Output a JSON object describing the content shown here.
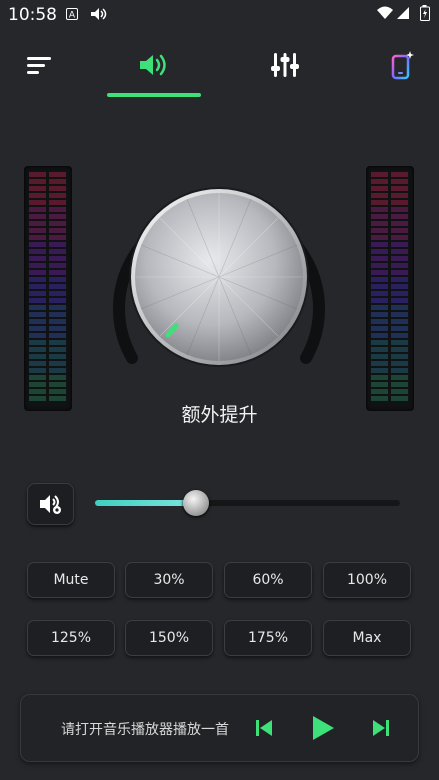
{
  "status_bar": {
    "time": "10:58",
    "icons": [
      "a-badge-icon",
      "sound-indicator-icon",
      "wifi-icon",
      "signal-icon",
      "battery-icon"
    ]
  },
  "nav": {
    "items": [
      {
        "name": "menu",
        "icon": "menu-icon"
      },
      {
        "name": "volume",
        "icon": "speaker-icon",
        "active": true
      },
      {
        "name": "equalizer",
        "icon": "sliders-icon"
      },
      {
        "name": "theme",
        "icon": "phone-sparkle-icon"
      }
    ],
    "accent": "#3ee07a"
  },
  "knob": {
    "caption": "额外提升",
    "indicator_color": "#3ee07a"
  },
  "volume": {
    "level_fraction": 0.33,
    "fill_color": "#5fdad0"
  },
  "presets": {
    "row1": [
      "Mute",
      "30%",
      "60%",
      "100%"
    ],
    "row2": [
      "125%",
      "150%",
      "175%",
      "Max"
    ]
  },
  "player": {
    "message": "请打开音乐播放器播放一首",
    "controls": [
      "previous-icon",
      "play-icon",
      "next-icon"
    ],
    "control_color": "#3ee07a"
  }
}
